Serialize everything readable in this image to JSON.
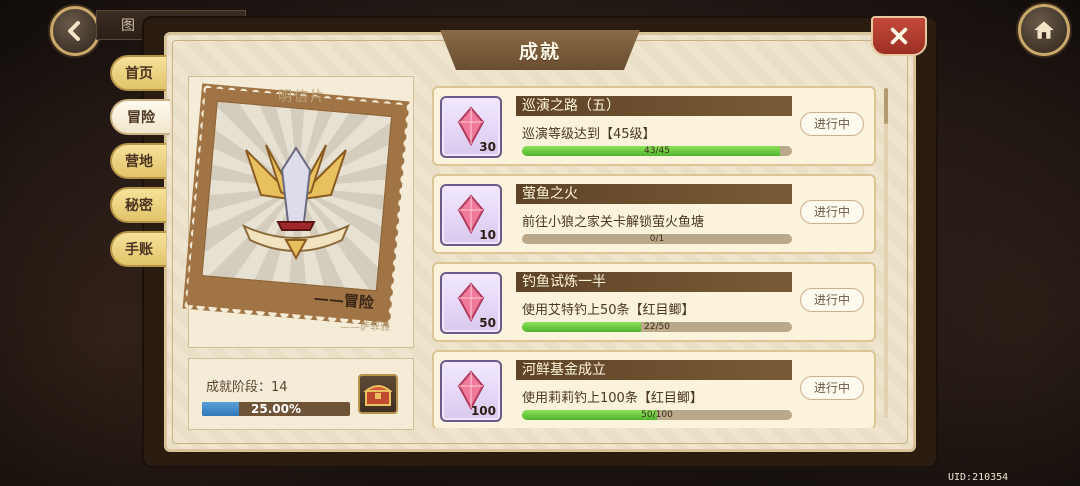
{
  "top_bar": {
    "tab_label": "图"
  },
  "window": {
    "title": "成就"
  },
  "side_nav": {
    "items": [
      {
        "label": "首页",
        "active": false
      },
      {
        "label": "冒险",
        "active": true
      },
      {
        "label": "营地",
        "active": false
      },
      {
        "label": "秘密",
        "active": false
      },
      {
        "label": "手账",
        "active": false
      }
    ]
  },
  "postcard": {
    "title": "明信片",
    "stamp_caption": "——冒险",
    "signature": "——萨菲雅"
  },
  "stage": {
    "label": "成就阶段：14",
    "progress_text": "25.00%",
    "progress": 0.25
  },
  "achievements": [
    {
      "title": "巡演之路（五）",
      "description": "巡演等级达到【45级】",
      "reward_count": "30",
      "progress_text": "43/45",
      "current": 43,
      "total": 45,
      "status": "进行中"
    },
    {
      "title": "萤鱼之火",
      "description": "前往小狼之家关卡解锁萤火鱼塘",
      "reward_count": "10",
      "progress_text": "0/1",
      "current": 0,
      "total": 1,
      "status": "进行中"
    },
    {
      "title": "钓鱼试炼一半",
      "description": "使用艾特钓上50条【红目鲫】",
      "reward_count": "50",
      "progress_text": "22/50",
      "current": 22,
      "total": 50,
      "status": "进行中"
    },
    {
      "title": "河鲜基金成立",
      "description": "使用莉莉钓上100条【红目鲫】",
      "reward_count": "100",
      "progress_text": "50/100",
      "current": 50,
      "total": 100,
      "status": "进行中"
    }
  ],
  "footer": {
    "uid": "UID:210354"
  },
  "colors": {
    "accent": "#6a4d30",
    "progress_green": "#4fb52c",
    "stage_blue": "#2f78b8",
    "close_red": "#c44a3a"
  }
}
